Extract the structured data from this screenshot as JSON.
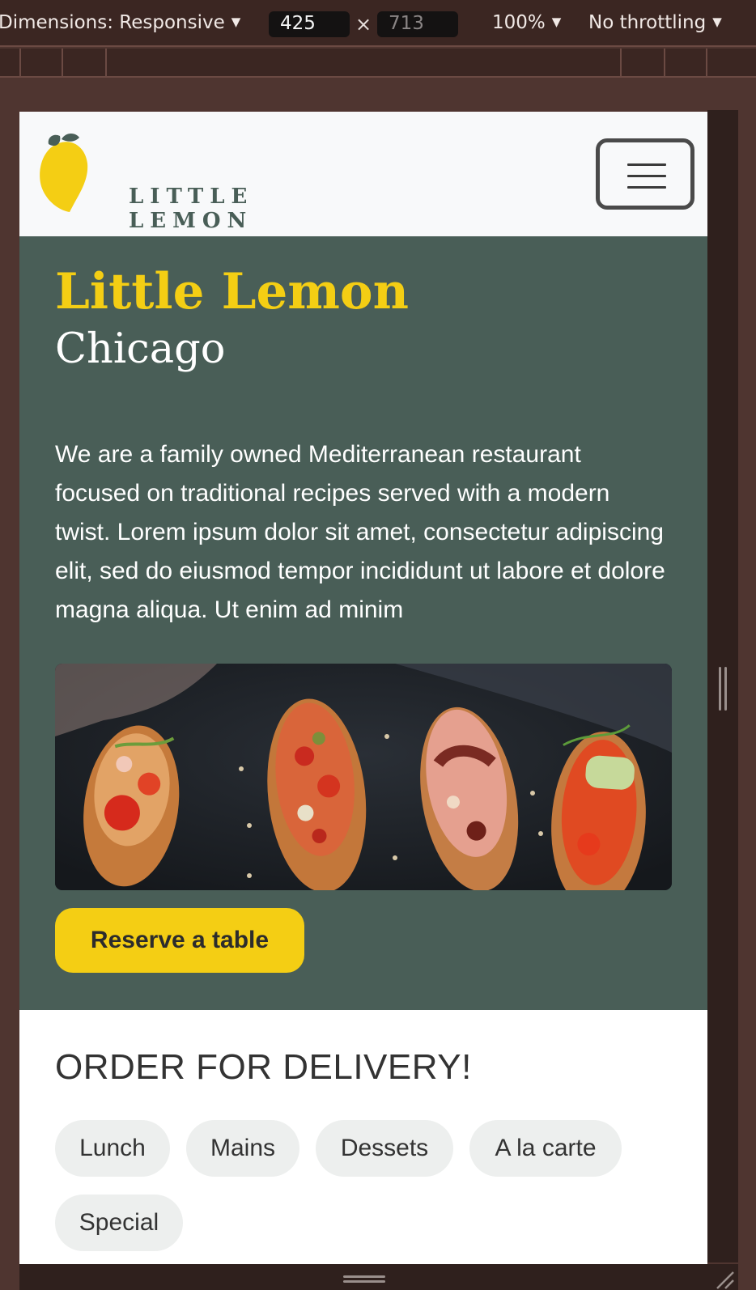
{
  "devtools": {
    "dimensions_label": "Dimensions: Responsive",
    "width_value": "425",
    "times_symbol": "×",
    "height_value": "713",
    "zoom_label": "100%",
    "throttling_label": "No throttling",
    "caret": "▼"
  },
  "navbar": {
    "logo_text": "LITTLE LEMON",
    "menu_icon": "hamburger-icon"
  },
  "hero": {
    "title": "Little Lemon",
    "subtitle": "Chicago",
    "description": "We are a family owned Mediterranean restaurant focused on traditional recipes served with a modern twist. Lorem ipsum dolor sit amet, consectetur adipiscing elit, sed do eiusmod tempor incididunt ut labore et dolore magna aliqua. Ut enim ad minim",
    "image": "bruschetta-photo",
    "reserve_label": "Reserve a table"
  },
  "delivery": {
    "heading": "ORDER FOR DELIVERY!",
    "categories": [
      "Lunch",
      "Mains",
      "Dessets",
      "A la carte",
      "Special"
    ]
  },
  "colors": {
    "primary_green": "#495e57",
    "primary_yellow": "#f4ce14",
    "devtools_bg": "#3b2622",
    "pill_bg": "#edefee"
  }
}
